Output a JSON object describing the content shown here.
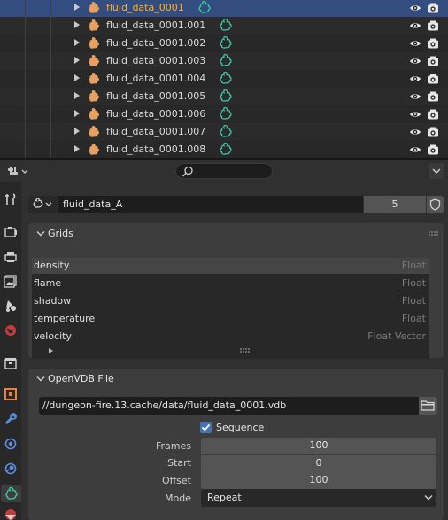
{
  "outliner": {
    "rows": [
      {
        "name": "fluid_data_0001",
        "selected": true
      },
      {
        "name": "fluid_data_0001.001",
        "selected": false
      },
      {
        "name": "fluid_data_0001.002",
        "selected": false
      },
      {
        "name": "fluid_data_0001.003",
        "selected": false
      },
      {
        "name": "fluid_data_0001.004",
        "selected": false
      },
      {
        "name": "fluid_data_0001.005",
        "selected": false
      },
      {
        "name": "fluid_data_0001.006",
        "selected": false
      },
      {
        "name": "fluid_data_0001.007",
        "selected": false
      },
      {
        "name": "fluid_data_0001.008",
        "selected": false
      }
    ]
  },
  "header": {
    "search_placeholder": ""
  },
  "datablock": {
    "name": "fluid_data_A",
    "users": "5"
  },
  "grids_panel": {
    "title": "Grids",
    "grids": [
      {
        "name": "density",
        "type": "Float"
      },
      {
        "name": "flame",
        "type": "Float"
      },
      {
        "name": "shadow",
        "type": "Float"
      },
      {
        "name": "temperature",
        "type": "Float"
      },
      {
        "name": "velocity",
        "type": "Float Vector"
      }
    ]
  },
  "openvdb_panel": {
    "title": "OpenVDB File",
    "filepath": "//dungeon-fire.13.cache/data/fluid_data_0001.vdb",
    "sequence_label": "Sequence",
    "sequence_checked": true,
    "frames_label": "Frames",
    "frames_value": "100",
    "start_label": "Start",
    "start_value": "0",
    "offset_label": "Offset",
    "offset_value": "100",
    "mode_label": "Mode",
    "mode_value": "Repeat"
  },
  "colors": {
    "selection_bg": "#334d80",
    "active_text": "#ffaf29",
    "volume_icon": "#e8a060",
    "data_icon": "#3ec4a0",
    "checkbox": "#4772b3"
  },
  "icons": {
    "editor_type": "properties-editor-icon",
    "tabs": [
      "tool-icon",
      "render-icon",
      "output-icon",
      "view-layer-icon",
      "scene-icon",
      "world-icon",
      "collection-icon",
      "object-icon",
      "modifier-icon",
      "particles-icon",
      "physics-icon",
      "volume-data-icon",
      "material-icon"
    ]
  }
}
